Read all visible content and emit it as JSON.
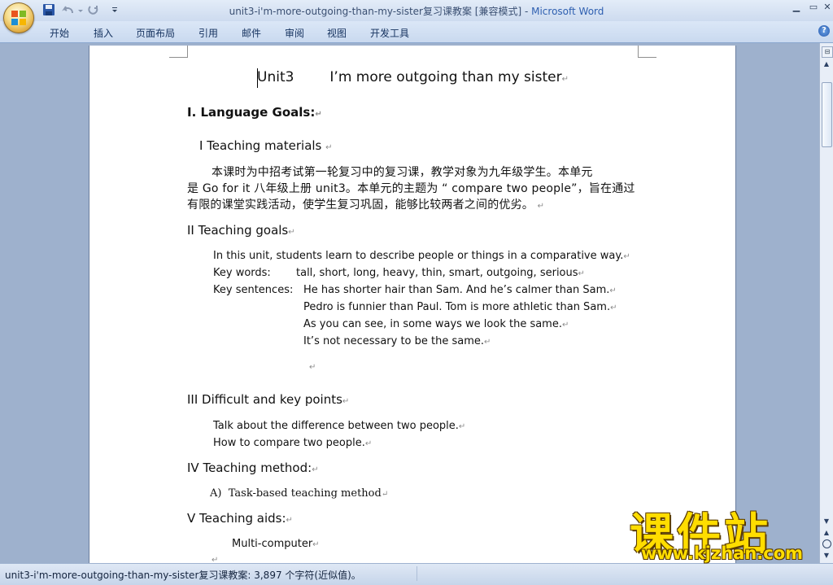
{
  "window": {
    "title_doc": "unit3-i'm-more-outgoing-than-my-sister复习课教案 [兼容模式] - ",
    "title_app": "Microsoft Word",
    "min_label": "▁",
    "max_label": "▭",
    "close_label": "✕"
  },
  "ribbon": {
    "tabs": [
      "开始",
      "插入",
      "页面布局",
      "引用",
      "邮件",
      "审阅",
      "视图",
      "开发工具"
    ],
    "help_label": "?"
  },
  "icons": {
    "office_button": "office-logo-icon",
    "save": "save-icon",
    "undo": "undo-icon",
    "redo": "redo-icon",
    "help": "help-icon"
  },
  "document": {
    "heading_left": "Unit3",
    "heading_right": "I’m more outgoing than my sister",
    "paragraph_mark": "↵",
    "s1": "I. Language Goals:",
    "s1a": "I Teaching materials",
    "cn1": "本课时为中招考试第一轮复习中的复习课，教学对象为九年级学生。本单元",
    "cn2": "是 Go for it 八年级上册 unit3。本单元的主题为 “ compare two people”，旨在通过",
    "cn3": "有限的课堂实践活动，使学生复习巩固，能够比较两者之间的优劣。",
    "s2": "II Teaching goals",
    "g1": "In this unit, students learn to describe people or things in a comparative way.",
    "kw_label": "Key words:",
    "kw_value": "tall, short, long, heavy, thin, smart, outgoing, serious",
    "ks_label": "Key sentences:",
    "ks1": "He has shorter hair than Sam. And he’s calmer than Sam.",
    "ks2": "Pedro is funnier than Paul. Tom is more athletic than Sam.",
    "ks3": "As you can see, in some ways we look the same.",
    "ks4": "It’s not necessary to be the same.",
    "s3": "III Difficult and key points",
    "d1": "Talk about the difference between two people.",
    "d2": "How to compare two people.",
    "s4": "IV Teaching method:",
    "m1_prefix": "A)",
    "m1": "Task-based teaching method",
    "s5": "V Teaching aids:",
    "a1": "Multi-computer"
  },
  "scrollbar": {
    "up": "▲",
    "down": "▼",
    "prev_page": "▲",
    "next_page": "▼",
    "ruler": "⊟"
  },
  "status": {
    "text": "unit3-i'm-more-outgoing-than-my-sister复习课教案: 3,897 个字符(近似值)。"
  },
  "watermark": {
    "cn": "课件站",
    "url": "www.kjzhan.com"
  }
}
